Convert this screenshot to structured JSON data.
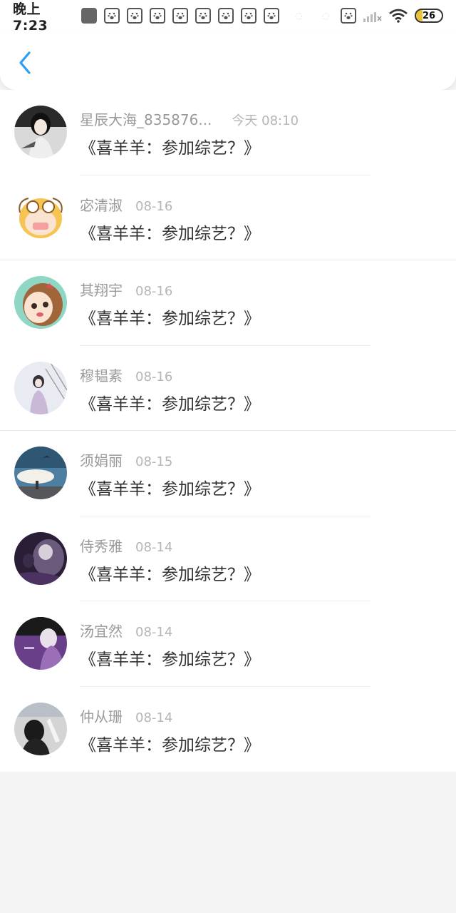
{
  "status_bar": {
    "time": "晚上7:23",
    "battery": "26",
    "battery_level": 0.26
  },
  "nav": {
    "back_icon": "chevron-left-icon",
    "accent": "#2a9df4"
  },
  "messages": [
    {
      "name": "星辰大海_835876...",
      "date": "今天 08:10",
      "text": "《喜羊羊：参加综艺？》"
    },
    {
      "name": "宓清淑",
      "date": "08-16",
      "text": "《喜羊羊：参加综艺？》"
    },
    {
      "name": "其翔宇",
      "date": "08-16",
      "text": "《喜羊羊：参加综艺？》"
    },
    {
      "name": "穆韫素",
      "date": "08-16",
      "text": "《喜羊羊：参加综艺？》"
    },
    {
      "name": "须娟丽",
      "date": "08-15",
      "text": "《喜羊羊：参加综艺？》"
    },
    {
      "name": "侍秀雅",
      "date": "08-14",
      "text": "《喜羊羊：参加综艺？》"
    },
    {
      "name": "汤宜然",
      "date": "08-14",
      "text": "《喜羊羊：参加综艺？》"
    },
    {
      "name": "仲从珊",
      "date": "08-14",
      "text": "《喜羊羊：参加综艺？》"
    }
  ]
}
